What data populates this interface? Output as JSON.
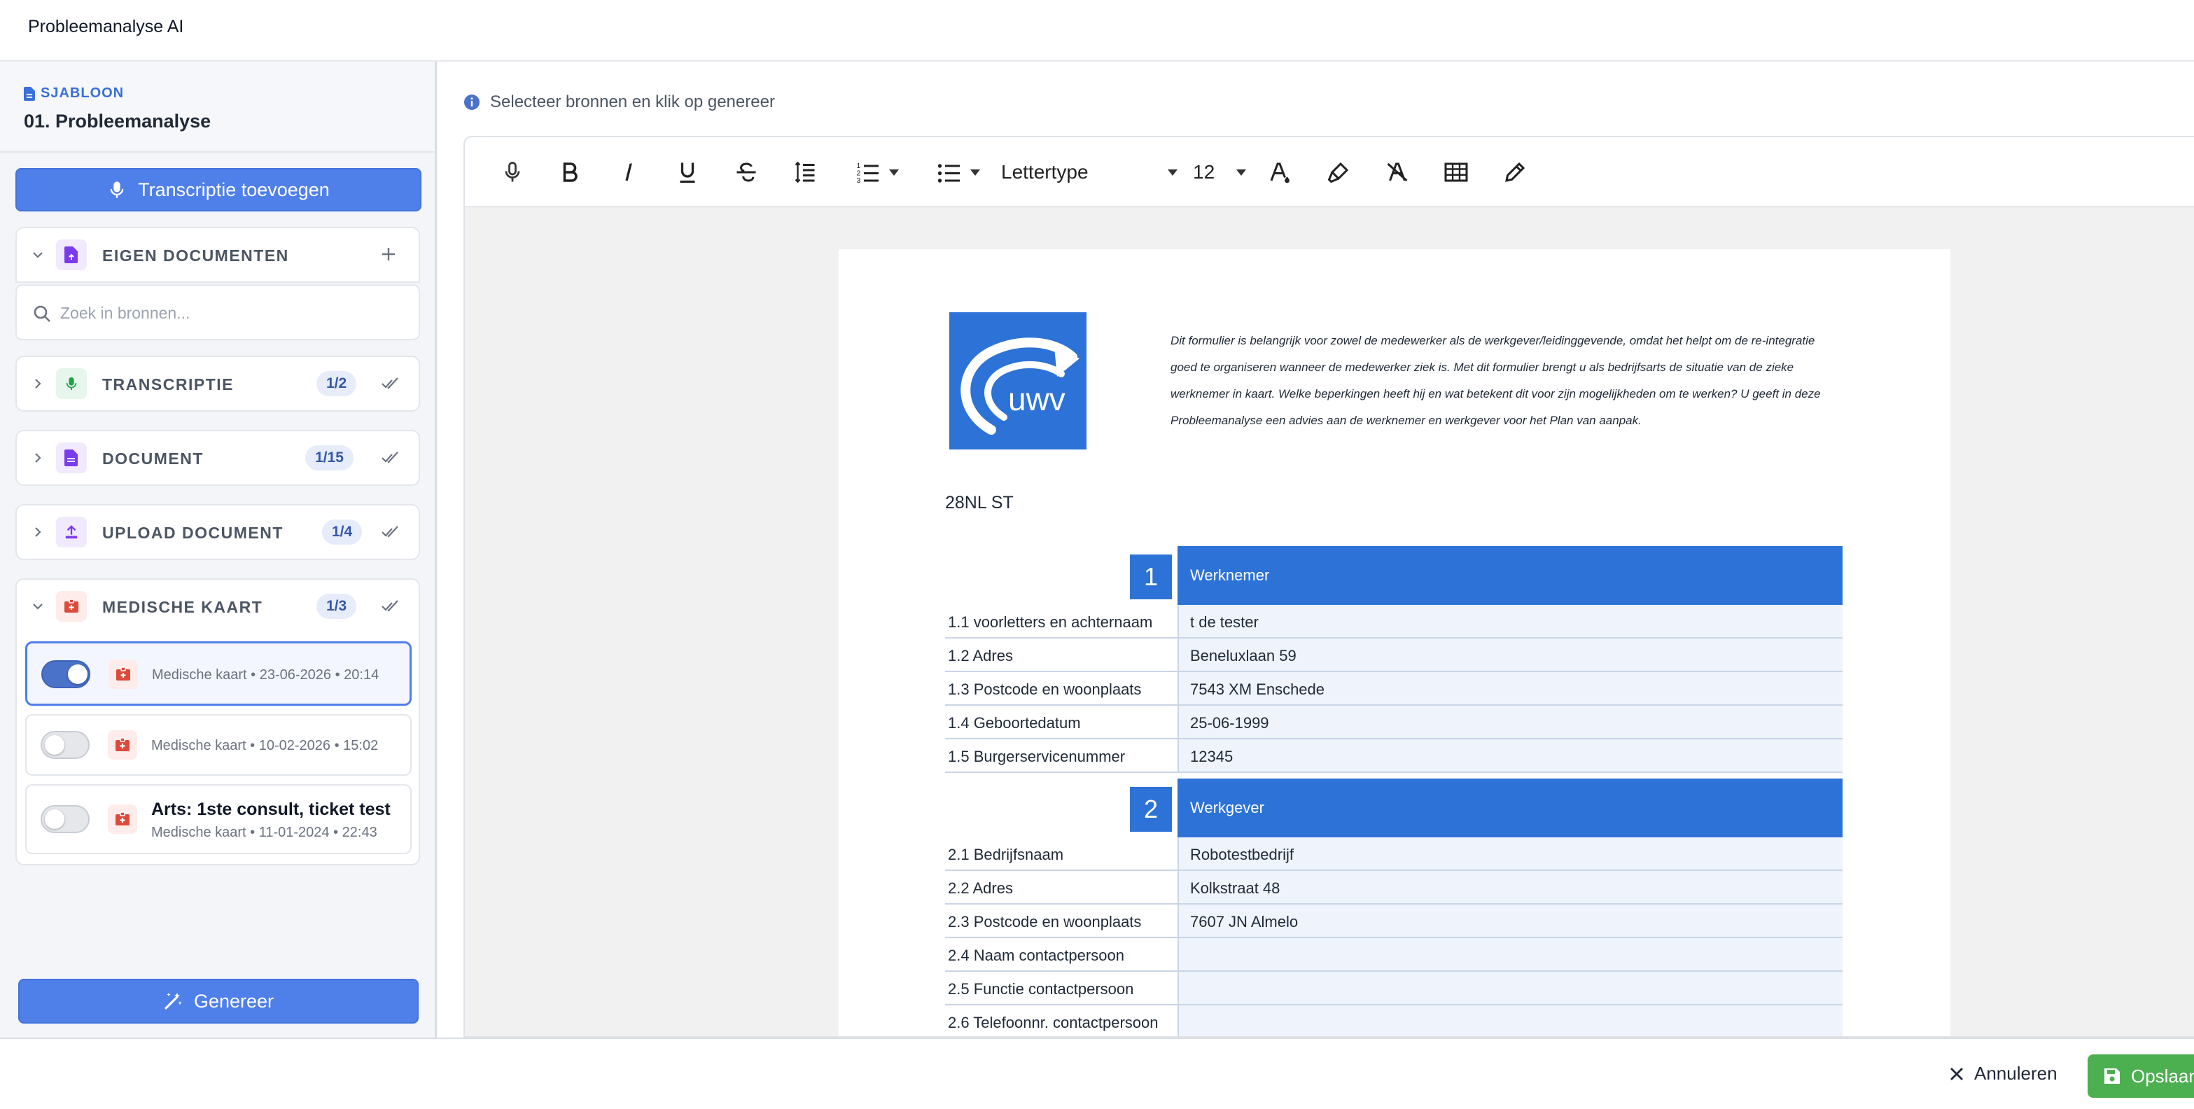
{
  "window": {
    "title": "Probleemanalyse AI"
  },
  "sidebar": {
    "template_kicker": "SJABLOON",
    "template_name": "01. Probleemanalyse",
    "add_transcript_label": "Transcriptie toevoegen",
    "own_documents_label": "EIGEN DOCUMENTEN",
    "search_placeholder": "Zoek in bronnen...",
    "sections": [
      {
        "label": "TRANSCRIPTIE",
        "count": "1/2",
        "color": "#22a34a"
      },
      {
        "label": "DOCUMENT",
        "count": "1/15",
        "color": "#7c3aed"
      },
      {
        "label": "UPLOAD DOCUMENT",
        "count": "1/4",
        "color": "#7c3aed"
      },
      {
        "label": "MEDISCHE KAART",
        "count": "1/3",
        "color": "#dc4a3b"
      }
    ],
    "medical_items": [
      {
        "title": "",
        "meta": "Medische kaart • 23-06-2026 • 20:14",
        "enabled": true
      },
      {
        "title": "",
        "meta": "Medische kaart • 10-02-2026 • 15:02",
        "enabled": false
      },
      {
        "title": "Arts: 1ste consult, ticket test",
        "meta": "Medische kaart • 11-01-2024 • 22:43",
        "enabled": false
      }
    ],
    "generate_label": "Genereer"
  },
  "main": {
    "hint": "Selecteer bronnen en klik op genereer",
    "toolbar": {
      "font_family": "Lettertype",
      "font_size": "12"
    },
    "document": {
      "logo_text": "uwv",
      "intro": "Dit formulier is belangrijk voor zowel de medewerker als de werkgever/leidinggevende, omdat het helpt om de re-integratie goed te organiseren wanneer de medewerker ziek is. Met dit formulier brengt u als bedrijfsarts de situatie van de zieke werknemer in kaart. Welke beperkingen heeft hij en wat betekent dit voor zijn mogelijkheden om te werken? U geeft in deze Probleemanalyse een advies aan de werknemer en werkgever voor het Plan van aanpak.",
      "doc_number": "28NL ST",
      "section1": {
        "number": "1",
        "title": "Werknemer",
        "rows": [
          {
            "label": "1.1 voorletters en achternaam",
            "value": "t de tester"
          },
          {
            "label": "1.2 Adres",
            "value": "Beneluxlaan 59"
          },
          {
            "label": "1.3 Postcode en woonplaats",
            "value": "7543 XM Enschede"
          },
          {
            "label": "1.4 Geboortedatum",
            "value": "25-06-1999"
          },
          {
            "label": "1.5 Burgerservicenummer",
            "value": "12345"
          }
        ]
      },
      "section2": {
        "number": "2",
        "title": "Werkgever",
        "rows": [
          {
            "label": "2.1 Bedrijfsnaam",
            "value": "Robotestbedrijf"
          },
          {
            "label": "2.2 Adres",
            "value": "Kolkstraat 48"
          },
          {
            "label": "2.3 Postcode en woonplaats",
            "value": "7607 JN Almelo"
          },
          {
            "label": "2.4 Naam contactpersoon",
            "value": ""
          },
          {
            "label": "2.5 Functie contactpersoon",
            "value": ""
          },
          {
            "label": "2.6 Telefoonnr. contactpersoon",
            "value": ""
          }
        ]
      }
    }
  },
  "footer": {
    "cancel_label": "Annuleren",
    "save_label": "Opslaan"
  }
}
